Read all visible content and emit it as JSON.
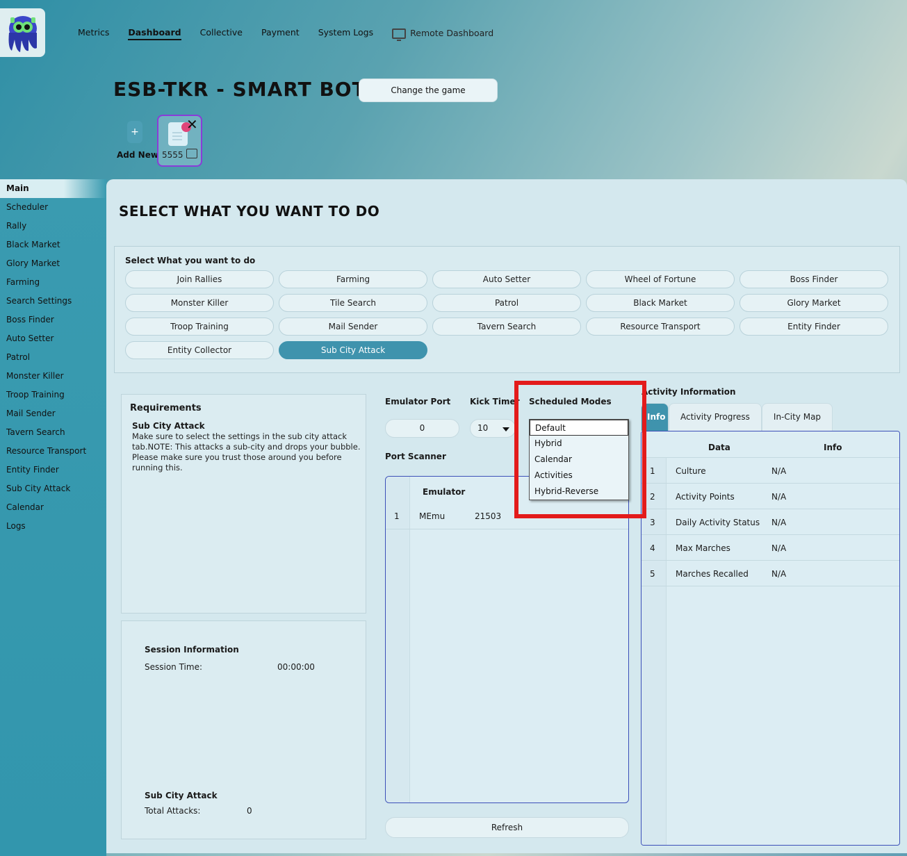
{
  "nav": {
    "items": [
      "Metrics",
      "Dashboard",
      "Collective",
      "Payment",
      "System Logs"
    ],
    "active": "Dashboard",
    "remote": "Remote Dashboard"
  },
  "header": {
    "title": "ESB-TKR - SMART BOT",
    "change_game": "Change the game",
    "add_new": "Add New",
    "profile_name": "5555"
  },
  "sidebar": {
    "items": [
      "Main",
      "Scheduler",
      "Rally",
      "Black Market",
      "Glory Market",
      "Farming",
      "Search Settings",
      "Boss Finder",
      "Auto Setter",
      "Patrol",
      "Monster Killer",
      "Troop Training",
      "Mail Sender",
      "Tavern Search",
      "Resource Transport",
      "Entity Finder",
      "Sub City Attack",
      "Calendar",
      "Logs"
    ],
    "active": "Main"
  },
  "main": {
    "title": "SELECT WHAT YOU WANT TO DO",
    "task_header": "Select What you want to do",
    "tasks": [
      "Join Rallies",
      "Farming",
      "Auto Setter",
      "Wheel of Fortune",
      "Boss Finder",
      "Monster Killer",
      "Tile Search",
      "Patrol",
      "Black Market",
      "Glory Market",
      "Troop Training",
      "Mail Sender",
      "Tavern Search",
      "Resource Transport",
      "Entity Finder",
      "Entity Collector",
      "Sub City Attack"
    ],
    "selected_task": "Sub City Attack"
  },
  "requirements": {
    "heading": "Requirements",
    "subheading": "Sub City Attack",
    "text": "Make sure to select the settings in the sub city attack tab.NOTE: This attacks a sub-city and drops your bubble. Please make sure you trust those around you before running this."
  },
  "session": {
    "heading": "Session Information",
    "time_label": "Session Time:",
    "time_value": "00:00:00",
    "attack_heading": "Sub City Attack",
    "attacks_label": "Total Attacks:",
    "attacks_value": "0"
  },
  "controls": {
    "emulator_port_label": "Emulator Port",
    "emulator_port_value": "0",
    "kick_timer_label": "Kick Timer",
    "kick_timer_value": "10",
    "scheduled_modes_label": "Scheduled Modes",
    "scheduled_modes_options": [
      "Default",
      "Hybrid",
      "Calendar",
      "Activities",
      "Hybrid-Reverse"
    ],
    "scheduled_modes_selected": "Default",
    "port_scanner_label": "Port Scanner",
    "refresh": "Refresh"
  },
  "scanner": {
    "header": "Emulator",
    "rows": [
      {
        "index": "1",
        "emulator": "MEmu",
        "port": "21503"
      }
    ]
  },
  "activity": {
    "title": "Activity Information",
    "tabs": [
      "Info",
      "Activity Progress",
      "In-City Map"
    ],
    "active_tab": "Info",
    "columns": [
      "Data",
      "Info"
    ],
    "rows": [
      {
        "index": "1",
        "data": "Culture",
        "info": "N/A"
      },
      {
        "index": "2",
        "data": "Activity Points",
        "info": "N/A"
      },
      {
        "index": "3",
        "data": "Daily Activity Status",
        "info": "N/A"
      },
      {
        "index": "4",
        "data": "Max Marches",
        "info": "N/A"
      },
      {
        "index": "5",
        "data": "Marches Recalled",
        "info": "N/A"
      }
    ]
  },
  "colors": {
    "accent": "#3f93ad",
    "highlight": "#e31b1b",
    "profile_border": "#8a3cd8"
  }
}
